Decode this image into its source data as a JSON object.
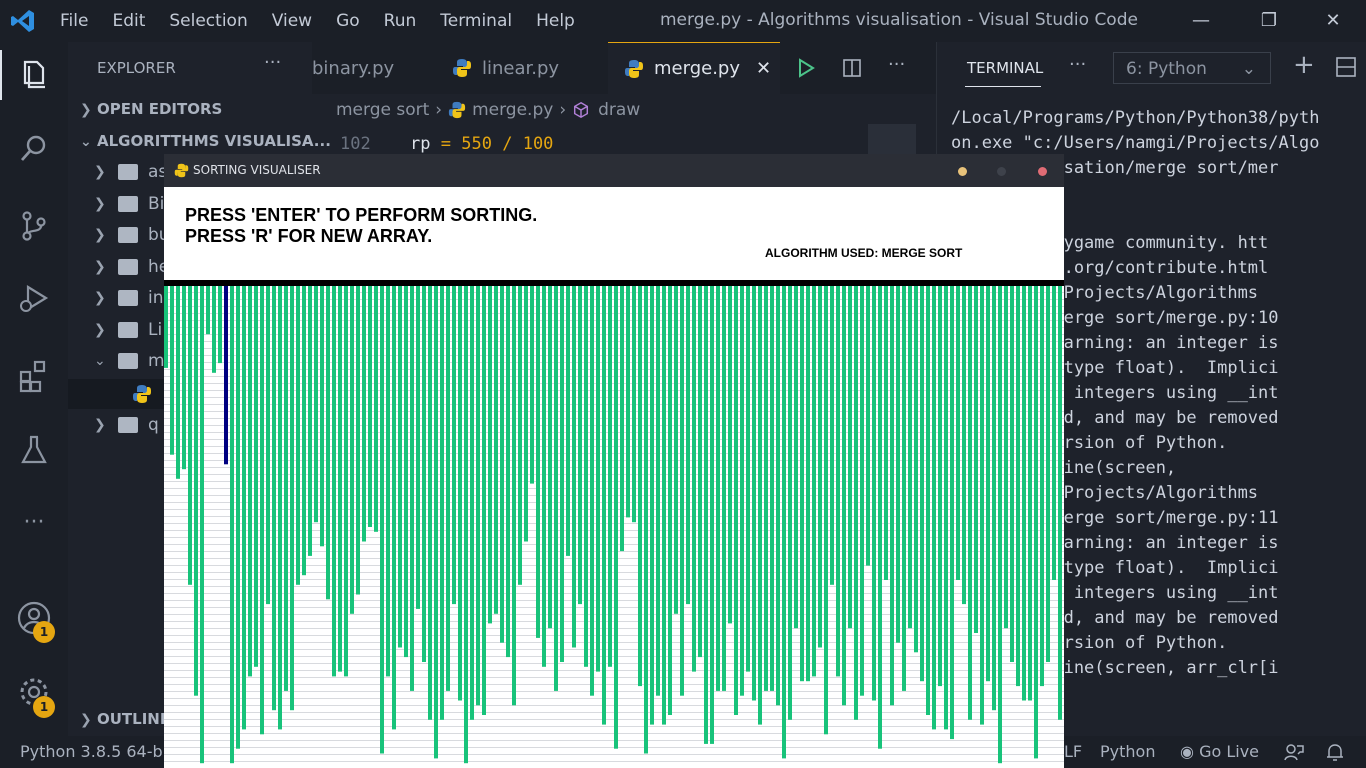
{
  "window": {
    "title": "merge.py - Algorithms visualisation - Visual Studio Code"
  },
  "menu": [
    "File",
    "Edit",
    "Selection",
    "View",
    "Go",
    "Run",
    "Terminal",
    "Help"
  ],
  "sidebar": {
    "header": "EXPLORER",
    "open_editors": "OPEN EDITORS",
    "project": "ALGORITTHMS VISUALISA...",
    "items": [
      {
        "label": "as",
        "open": false
      },
      {
        "label": "Bi",
        "open": false
      },
      {
        "label": "bu",
        "open": false
      },
      {
        "label": "he",
        "open": false
      },
      {
        "label": "in",
        "open": false
      },
      {
        "label": "Li",
        "open": false
      },
      {
        "label": "m",
        "open": true
      },
      {
        "label": "q",
        "open": false
      }
    ],
    "outline": "OUTLINE"
  },
  "tabs": [
    {
      "label": "binary.py",
      "active": false
    },
    {
      "label": "linear.py",
      "active": false
    },
    {
      "label": "merge.py",
      "active": true
    }
  ],
  "breadcrumb": [
    "merge sort",
    "merge.py",
    "draw"
  ],
  "editor": {
    "line_number": "102",
    "code_var": "rp",
    "code_eq": "=",
    "code_num1": "550",
    "code_op": "/",
    "code_num2": "100"
  },
  "terminal": {
    "tab": "TERMINAL",
    "selected": "6: Python",
    "lines": [
      "/Local/Programs/Python/Python38/pyth",
      "on.exe \"c:/Users/namgi/Projects/Algo",
      "      sualisation/merge sort/mer",
      "",
      "      .6",
      "      the pygame community. htt",
      "      ygame.org/contribute.html",
      "      amgi/Projects/Algorithms",
      "      ion/merge sort/merge.py:10",
      "      tionWarning: an integer is",
      "      (got type float).  Implici",
      "      on to integers using __int",
      "      ecated, and may be removed",
      "      re version of Python.",
      "      raw.line(screen,",
      "      amgi/Projects/Algorithms",
      "      ion/merge sort/merge.py:11",
      "      tionWarning: an integer is",
      "      (got type float).  Implici",
      "      on to integers using __int",
      "      ecated, and may be removed",
      "      re version of Python.",
      "      raw.line(screen, arr_clr[i"
    ]
  },
  "status": {
    "python": "Python 3.8.5 64-bit",
    "eol": "LF",
    "lang": "Python",
    "live": "Go Live"
  },
  "badges": {
    "account": "1",
    "settings": "1"
  },
  "pygame": {
    "title": "SORTING VISUALISER",
    "line1": "PRESS 'ENTER' TO PERFORM SORTING.",
    "line2": "PRESS 'R' FOR NEW ARRAY.",
    "algorithm": "ALGORITHM USED: MERGE SORT",
    "bar_color": "#18c37a",
    "highlight_color": "#000080",
    "highlight_index": 10,
    "bar_depths": [
      0.17,
      0.35,
      0.4,
      0.38,
      0.62,
      0.85,
      0.99,
      0.1,
      0.18,
      0.16,
      0.37,
      0.99,
      0.96,
      0.92,
      0.81,
      0.79,
      0.93,
      0.66,
      0.88,
      0.92,
      0.84,
      0.88,
      0.62,
      0.6,
      0.56,
      0.49,
      0.54,
      0.65,
      0.81,
      0.8,
      0.81,
      0.68,
      0.64,
      0.53,
      0.5,
      0.51,
      0.97,
      0.81,
      0.92,
      0.75,
      0.77,
      0.84,
      0.67,
      0.78,
      0.9,
      0.98,
      0.9,
      0.84,
      0.66,
      0.86,
      0.99,
      0.9,
      0.87,
      0.89,
      0.7,
      0.68,
      0.74,
      0.77,
      0.87,
      0.62,
      0.53,
      0.41,
      0.73,
      0.79,
      0.71,
      0.84,
      0.78,
      0.56,
      0.75,
      0.66,
      0.79,
      0.85,
      0.8,
      0.91,
      0.79,
      0.96,
      0.55,
      0.48,
      0.49,
      0.83,
      0.97,
      0.91,
      0.85,
      0.91,
      0.89,
      0.68,
      0.85,
      0.66,
      0.8,
      0.77,
      0.95,
      0.95,
      0.84,
      0.84,
      0.7,
      0.89,
      0.85,
      0.8,
      0.86,
      0.91,
      0.84,
      0.84,
      0.87,
      0.98,
      0.9,
      0.71,
      0.82,
      0.82,
      0.81,
      0.75,
      0.93,
      0.62,
      0.81,
      0.87,
      0.71,
      0.9,
      0.85,
      0.58,
      0.86,
      0.96,
      0.61,
      0.87,
      0.74,
      0.84,
      0.71,
      0.76,
      0.82,
      0.89,
      0.92,
      0.83,
      0.92,
      0.94,
      0.61,
      0.66,
      0.9,
      0.72,
      0.91,
      0.82,
      0.88,
      0.99,
      0.71,
      0.78,
      0.83,
      0.86,
      0.86,
      0.98,
      0.83,
      0.78,
      0.61,
      0.9
    ]
  }
}
